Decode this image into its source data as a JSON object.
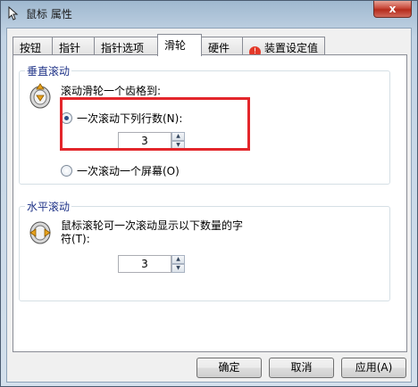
{
  "window": {
    "title": "鼠标 属性",
    "close_glyph": "x"
  },
  "tabs": [
    {
      "label": "按钮"
    },
    {
      "label": "指针"
    },
    {
      "label": "指针选项"
    },
    {
      "label": "滑轮",
      "active": true
    },
    {
      "label": "硬件"
    },
    {
      "label": "装置设定值",
      "icon": "warning-icon"
    }
  ],
  "vertical": {
    "title": "垂直滚动",
    "description": "滚动滑轮一个齿格到:",
    "option_lines": "一次滚动下列行数(N):",
    "option_screen": "一次滚动一个屏幕(O)",
    "lines_value": "3",
    "icon": "mouse-wheel-vertical-icon"
  },
  "horizontal": {
    "title": "水平滚动",
    "description_line1": "鼠标滚轮可一次滚动显示以下数量的字",
    "description_line2": "符(T):",
    "chars_value": "3",
    "icon": "mouse-wheel-horizontal-icon"
  },
  "buttons": {
    "ok": "确定",
    "cancel": "取消",
    "apply": "应用(A)"
  },
  "colors": {
    "highlight": "#e3262b",
    "group_title": "#1e3287"
  }
}
